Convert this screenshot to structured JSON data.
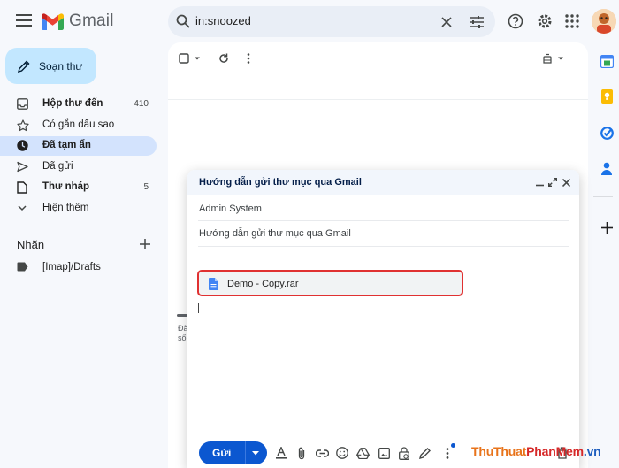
{
  "app": {
    "logo_text": "Gmail"
  },
  "search": {
    "value": "in:snoozed"
  },
  "compose_button": {
    "label": "Soạn thư"
  },
  "sidebar": {
    "items": [
      {
        "label": "Hộp thư đến",
        "count": "410",
        "icon": "inbox-icon",
        "bold": true
      },
      {
        "label": "Có gắn dấu sao",
        "count": "",
        "icon": "star-icon",
        "bold": false
      },
      {
        "label": "Đã tạm ẩn",
        "count": "",
        "icon": "clock-icon",
        "bold": true,
        "active": true
      },
      {
        "label": "Đã gửi",
        "count": "",
        "icon": "send-icon",
        "bold": false
      },
      {
        "label": "Thư nháp",
        "count": "5",
        "icon": "draft-icon",
        "bold": true
      },
      {
        "label": "Hiện thêm",
        "count": "",
        "icon": "chevron-down-icon",
        "bold": false
      }
    ],
    "labels_title": "Nhãn",
    "labels": [
      {
        "label": "[Imap]/Drafts"
      }
    ]
  },
  "main": {
    "snippet_line1": "Đã",
    "snippet_line2": "số"
  },
  "compose_window": {
    "title": "Hướng dẫn gửi thư mục qua Gmail",
    "to": "Admin System",
    "subject": "Hướng dẫn gửi thư mục qua Gmail",
    "attachment": {
      "name": "Demo - Copy.rar",
      "icon": "file-icon"
    },
    "send_label": "Gửi"
  },
  "watermark": {
    "part1": "ThuThuat",
    "part2": "PhanMem",
    "part3": ".vn",
    "colors": {
      "part1": "#e8731a",
      "part2": "#d62828",
      "part3": "#1f5fbf"
    }
  },
  "colors": {
    "accent": "#0b57d0",
    "active_nav": "#d3e3fd",
    "compose_bg": "#c2e7ff",
    "highlight_border": "#e03131"
  }
}
